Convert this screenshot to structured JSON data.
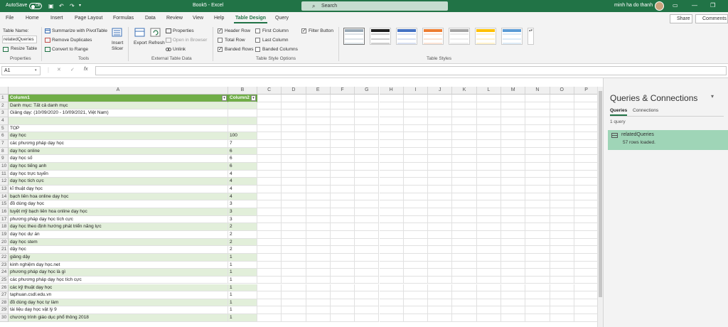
{
  "titlebar": {
    "autosave_label": "AutoSave",
    "autosave_state": "Off",
    "doc_title": "Book5 - Excel",
    "search_placeholder": "Search",
    "user_name": "minh ha do thanh"
  },
  "tabs": [
    "File",
    "Home",
    "Insert",
    "Page Layout",
    "Formulas",
    "Data",
    "Review",
    "View",
    "Help",
    "Table Design",
    "Query"
  ],
  "active_tab": "Table Design",
  "actions": {
    "share": "Share",
    "comments": "Comments"
  },
  "ribbon": {
    "properties": {
      "table_name_label": "Table Name:",
      "table_name_value": "relatedQueries",
      "resize": "Resize Table",
      "group": "Properties"
    },
    "tools": {
      "summarize": "Summarize with PivotTable",
      "remove_dup": "Remove Duplicates",
      "convert": "Convert to Range",
      "insert_slicer_1": "Insert",
      "insert_slicer_2": "Slicer",
      "group": "Tools"
    },
    "external": {
      "export": "Export",
      "refresh": "Refresh",
      "properties": "Properties",
      "open_browser": "Open in Browser",
      "unlink": "Unlink",
      "group": "External Table Data"
    },
    "style_options": {
      "header_row": "Header Row",
      "total_row": "Total Row",
      "banded_rows": "Banded Rows",
      "first_column": "First Column",
      "last_column": "Last Column",
      "banded_columns": "Banded Columns",
      "filter_button": "Filter Button",
      "group": "Table Style Options"
    },
    "table_styles": {
      "group": "Table Styles"
    }
  },
  "formula_bar": {
    "name_box": "A1",
    "fx": "fx",
    "cancel": "✕",
    "enter": "✓"
  },
  "grid": {
    "columns": [
      "A",
      "B",
      "C",
      "D",
      "E",
      "F",
      "G",
      "H",
      "I",
      "J",
      "K",
      "L",
      "M",
      "N",
      "O",
      "P"
    ],
    "header": [
      "Column1",
      "Column2"
    ],
    "rows": [
      [
        "Danh mục: Tất cả danh mục",
        ""
      ],
      [
        "Giảng dạy: (10/09/2020 - 10/09/2021, Việt Nam)",
        ""
      ],
      [
        "",
        ""
      ],
      [
        "TOP",
        ""
      ],
      [
        "dạy học",
        "100"
      ],
      [
        "các phương pháp dạy học",
        "7"
      ],
      [
        "dạy học online",
        "6"
      ],
      [
        "dạy học số",
        "6"
      ],
      [
        "dạy học tiếng anh",
        "6"
      ],
      [
        "dạy học trực tuyến",
        "4"
      ],
      [
        "dạy học tích cực",
        "4"
      ],
      [
        "kĩ thuật dạy học",
        "4"
      ],
      [
        "bạch liên hoa online dạy học",
        "4"
      ],
      [
        "đồ dùng dạy học",
        "3"
      ],
      [
        "tuyệt mỹ bạch liên hoa online dạy học",
        "3"
      ],
      [
        "phương pháp dạy học tích cực",
        "3"
      ],
      [
        "dạy học theo định hướng phát triển năng lực",
        "2"
      ],
      [
        "dạy học dự án",
        "2"
      ],
      [
        "dạy học stem",
        "2"
      ],
      [
        "dậy học",
        "2"
      ],
      [
        "giảng dậy",
        "1"
      ],
      [
        "kinh nghiệm dạy học.net",
        "1"
      ],
      [
        "phương pháp dạy học là gì",
        "1"
      ],
      [
        "các phương pháp dạy học tích cực",
        "1"
      ],
      [
        "các kỹ thuật dạy học",
        "1"
      ],
      [
        "taphuan.csdl.edu.vn",
        "1"
      ],
      [
        "đồ dùng dạy học tự làm",
        "1"
      ],
      [
        "tài liệu dạy học vật lý 9",
        "1"
      ],
      [
        "chương trình giáo dục phổ thông 2018",
        "1"
      ]
    ]
  },
  "queries_pane": {
    "title": "Queries & Connections",
    "tab_queries": "Queries",
    "tab_connections": "Connections",
    "count": "1 query",
    "item_name": "relatedQueries",
    "item_rows": "57 rows loaded."
  },
  "colors": {
    "excel_green": "#217346",
    "table_header": "#70ad47",
    "band": "#e2efda",
    "query_selected": "#9fd5b7"
  }
}
